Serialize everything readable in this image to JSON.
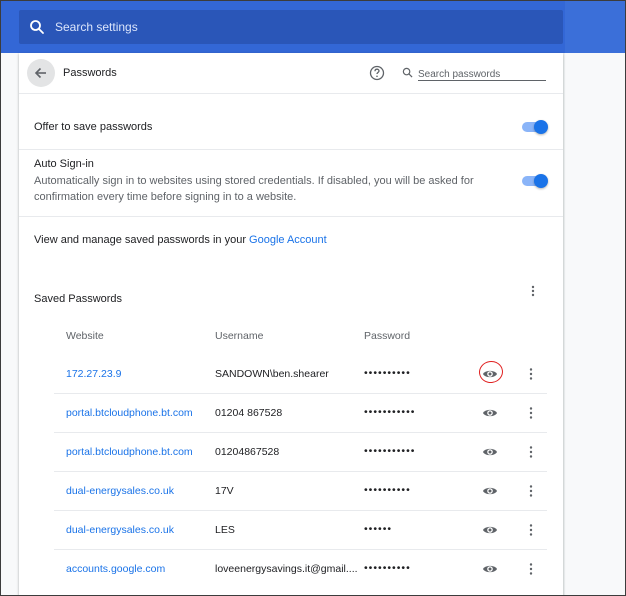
{
  "search_settings": {
    "placeholder": "Search settings"
  },
  "header": {
    "title": "Passwords",
    "search_placeholder": "Search passwords"
  },
  "offer_to_save": {
    "label": "Offer to save passwords",
    "enabled": true
  },
  "auto_signin": {
    "label": "Auto Sign-in",
    "description": "Automatically sign in to websites using stored credentials. If disabled, you will be asked for confirmation every time before signing in to a website.",
    "enabled": true
  },
  "manage": {
    "text": "View and manage saved passwords in your ",
    "link": "Google Account"
  },
  "saved_passwords": {
    "title": "Saved Passwords",
    "columns": {
      "website": "Website",
      "username": "Username",
      "password": "Password"
    },
    "rows": [
      {
        "website": "172.27.23.9",
        "username": "SANDOWN\\ben.shearer",
        "password": "••••••••••"
      },
      {
        "website": "portal.btcloudphone.bt.com",
        "username": "01204 867528",
        "password": "•••••••••••"
      },
      {
        "website": "portal.btcloudphone.bt.com",
        "username": "01204867528",
        "password": "•••••••••••"
      },
      {
        "website": "dual-energysales.co.uk",
        "username": "17V",
        "password": "••••••••••"
      },
      {
        "website": "dual-energysales.co.uk",
        "username": "LES",
        "password": "••••••"
      },
      {
        "website": "accounts.google.com",
        "username": "loveenergysavings.it@gmail....",
        "password": "••••••••••"
      }
    ]
  },
  "colors": {
    "accent": "#1a73e8",
    "toolbar": "#3367d6",
    "annotation": "#e02020"
  }
}
